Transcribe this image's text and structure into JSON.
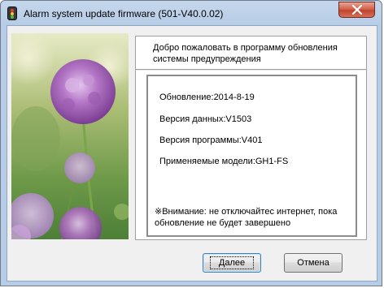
{
  "window": {
    "title": "Alarm system update firmware (501-V40.0.02)"
  },
  "panel": {
    "welcome": "Добро пожаловать в программу обновления системы предупреждения",
    "info": {
      "update_date": "Обновление:2014-8-19",
      "data_version": "Версия данных:V1503",
      "program_version": "Версия программы:V401",
      "models": "Применяемые модели:GH1-FS"
    },
    "warning": "※Внимание: не отключайтес интернет, пока обновление не будет завершено"
  },
  "buttons": {
    "next": "Далее",
    "cancel": "Отмена"
  },
  "icons": {
    "app": "traffic-light-icon",
    "close": "close-icon"
  },
  "colors": {
    "close_button": "#c7452e",
    "flower": "#a45bb8"
  }
}
